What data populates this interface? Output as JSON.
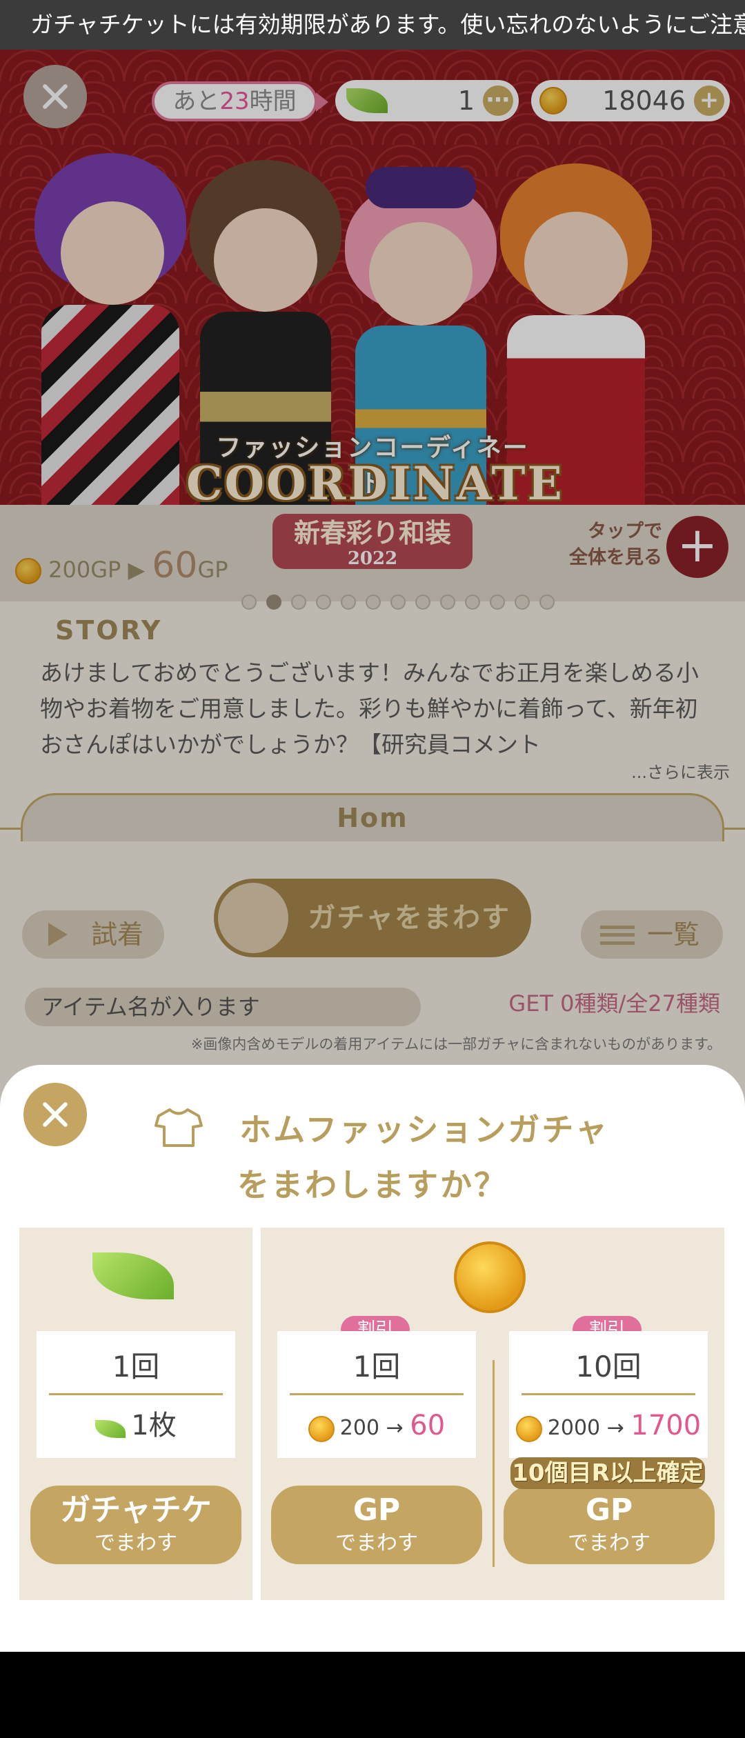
{
  "ticker": {
    "text": "ガチャチケットには有効期限があります。使い忘れのないようにご注意ください。"
  },
  "header": {
    "time_prefix": "あと",
    "time_number": "23",
    "time_suffix": "時間",
    "leaf_count": "1",
    "coin_count": "18046"
  },
  "banner": {
    "subtitle": "ファッションコーディネート",
    "title": "COORDINATE"
  },
  "promo": {
    "old_price": "200",
    "old_unit": "GP",
    "new_price": "60",
    "new_unit": "GP",
    "event_name": "新春彩り和装",
    "event_year": "2022",
    "tap_label_1": "タップで",
    "tap_label_2": "全体を見る",
    "tap_button": "+"
  },
  "story": {
    "heading": "STORY",
    "text": "あけましておめでとうございます！みんなでお正月を楽しめる小物やお着物をご用意しました。彩りも鮮やかに着飾って、新年初おさんぽはいかがでしょうか？【研究員コメント",
    "more": "...さらに表示"
  },
  "tab": {
    "label": "Hom"
  },
  "actions": {
    "try_label": "試着",
    "spin_label": "ガチャをまわす",
    "list_label": "一覧"
  },
  "items": {
    "name_placeholder": "アイテム名が入ります",
    "get_count": "GET 0種類/全27種類",
    "disclaimer": "※画像内含めモデルの着用アイテムには一部ガチャに含まれないものがあります。"
  },
  "dialog": {
    "title_line1": "ホムファッションガチャ",
    "title_line2": "をまわしますか？",
    "ticket": {
      "count": "1回",
      "cost_amount": "1枚",
      "button_line1": "ガチャチケ",
      "button_line2": "でまわす"
    },
    "gp_single": {
      "badge": "割引",
      "count": "1回",
      "old_price": "200",
      "arrow": "→",
      "new_price": "60",
      "button_line1": "GP",
      "button_line2": "でまわす"
    },
    "gp_ten": {
      "badge": "割引",
      "count": "10回",
      "old_price": "2000",
      "arrow": "→",
      "new_price": "1700",
      "guarantee": "10個目R以上確定",
      "button_line1": "GP",
      "button_line2": "でまわす"
    }
  },
  "colors": {
    "gold": "#c4a562",
    "pink": "#e0709b",
    "banner_red": "#8c1a20",
    "panel_bg": "#efe8da"
  }
}
